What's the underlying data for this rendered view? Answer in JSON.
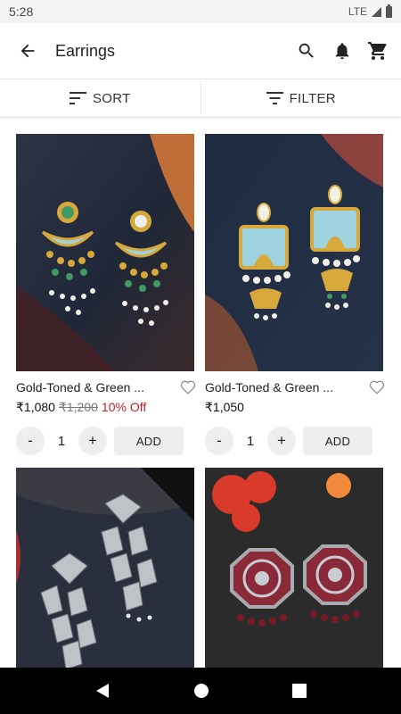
{
  "status": {
    "time": "5:28",
    "network": "LTE"
  },
  "header": {
    "title": "Earrings"
  },
  "toolbar": {
    "sort_label": "SORT",
    "filter_label": "FILTER"
  },
  "products": [
    {
      "name": "Gold-Toned & Green ...",
      "price": "₹1,080",
      "mrp": "₹1,200",
      "discount": "10% Off",
      "qty": "1",
      "add_label": "ADD",
      "minus": "-",
      "plus": "+"
    },
    {
      "name": "Gold-Toned & Green ...",
      "price": "₹1,050",
      "mrp": "",
      "discount": "",
      "qty": "1",
      "add_label": "ADD",
      "minus": "-",
      "plus": "+"
    },
    {
      "name": "",
      "price": "",
      "mrp": "",
      "discount": ""
    },
    {
      "name": "",
      "price": "",
      "mrp": "",
      "discount": ""
    }
  ],
  "icons": {
    "back": "arrow-back-icon",
    "search": "search-icon",
    "notifications": "bell-icon",
    "cart": "cart-icon",
    "sort": "sort-icon",
    "filter": "filter-icon",
    "wishlist": "heart-outline-icon"
  },
  "colors": {
    "discount": "#c0202a",
    "navbar": "#000000",
    "button_bg": "#eeeeee"
  }
}
